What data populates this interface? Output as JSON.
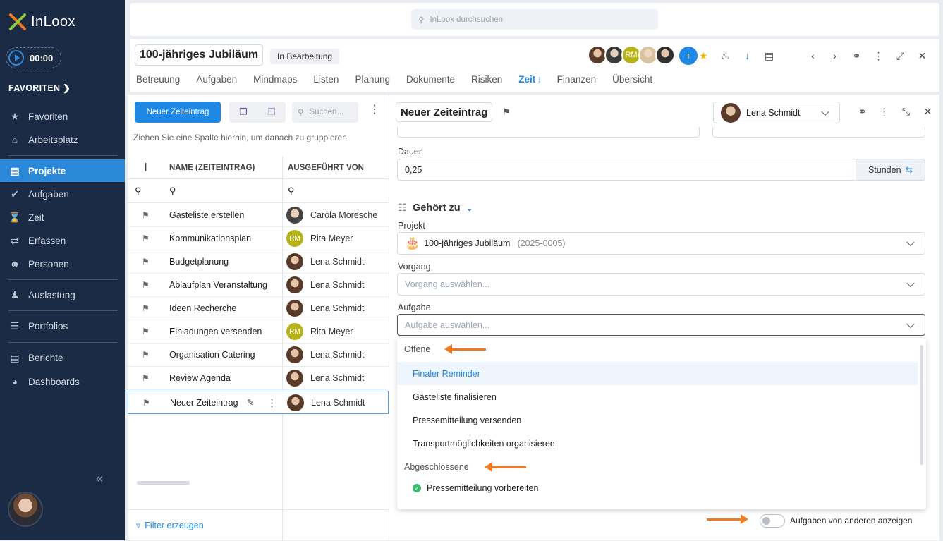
{
  "app": {
    "name": "InLoox",
    "timer": "00:00"
  },
  "sidebar": {
    "favorites_header": "FAVORITEN",
    "items": [
      {
        "label": "Favoriten",
        "icon": "star-icon"
      },
      {
        "label": "Arbeitsplatz",
        "icon": "home-icon"
      },
      {
        "label": "Projekte",
        "icon": "projects-icon",
        "active": true
      },
      {
        "label": "Aufgaben",
        "icon": "check-circle-icon"
      },
      {
        "label": "Zeit",
        "icon": "hourglass-icon"
      },
      {
        "label": "Erfassen",
        "icon": "capture-icon"
      },
      {
        "label": "Personen",
        "icon": "person-icon"
      },
      {
        "label": "Auslastung",
        "icon": "workload-icon"
      },
      {
        "label": "Portfolios",
        "icon": "portfolio-icon"
      },
      {
        "label": "Berichte",
        "icon": "report-icon"
      },
      {
        "label": "Dashboards",
        "icon": "dashboard-icon"
      }
    ]
  },
  "search": {
    "placeholder": "InLoox durchsuchen"
  },
  "project": {
    "title": "100-jähriges Jubiläum",
    "status": "In Bearbeitung",
    "tabs": [
      "Betreuung",
      "Aufgaben",
      "Mindmaps",
      "Listen",
      "Planung",
      "Dokumente",
      "Risiken",
      "Zeit",
      "Finanzen",
      "Übersicht"
    ],
    "active_tab": "Zeit",
    "team_initials": "RM"
  },
  "list": {
    "new_button": "Neuer Zeiteintrag",
    "search_placeholder": "Suchen...",
    "group_hint": "Ziehen Sie eine Spalte hierhin, um danach zu gruppieren",
    "col_name": "NAME (ZEITEINTRAG)",
    "col_by": "AUSGEFÜHRT VON",
    "rows": [
      {
        "name": "Gästeliste erstellen",
        "by": "Carola Moresche",
        "avatar": "photo"
      },
      {
        "name": "Kommunikationsplan",
        "by": "Rita Meyer",
        "avatar": "RM"
      },
      {
        "name": "Budgetplanung",
        "by": "Lena Schmidt",
        "avatar": "photo"
      },
      {
        "name": "Ablaufplan Veranstaltung",
        "by": "Lena Schmidt",
        "avatar": "photo"
      },
      {
        "name": "Ideen Recherche",
        "by": "Lena Schmidt",
        "avatar": "photo"
      },
      {
        "name": "Einladungen versenden",
        "by": "Rita Meyer",
        "avatar": "RM"
      },
      {
        "name": "Organisation Catering",
        "by": "Lena Schmidt",
        "avatar": "photo"
      },
      {
        "name": "Review Agenda",
        "by": "Lena Schmidt",
        "avatar": "photo"
      },
      {
        "name": "Neuer Zeiteintrag",
        "by": "Lena Schmidt",
        "avatar": "photo",
        "selected": true
      }
    ],
    "filter_label": "Filter erzeugen"
  },
  "detail": {
    "title": "Neuer Zeiteintrag",
    "user": "Lena Schmidt",
    "duration_label": "Dauer",
    "duration_value": "0,25",
    "unit": "Stunden",
    "belongs_to": "Gehört zu",
    "project_label": "Projekt",
    "project_value": "100-jähriges Jubiläum",
    "project_code": "(2025-0005)",
    "activity_label": "Vorgang",
    "activity_placeholder": "Vorgang auswählen...",
    "task_label": "Aufgabe",
    "task_placeholder": "Aufgabe auswählen...",
    "open_group": "Offene",
    "open_tasks": [
      "Finaler Reminder",
      "Gästeliste finalisieren",
      "Pressemitteilung versenden",
      "Transportmöglichkeiten organisieren"
    ],
    "done_group": "Abgeschlossene",
    "done_tasks": [
      "Pressemitteilung vorbereiten"
    ],
    "toggle_label": "Aufgaben von anderen anzeigen"
  },
  "colors": {
    "sidebar": "#1b2a45",
    "accent": "#1e88e5",
    "annotation_arrow": "#f07a1d",
    "rm_avatar": "#b5b21a"
  }
}
